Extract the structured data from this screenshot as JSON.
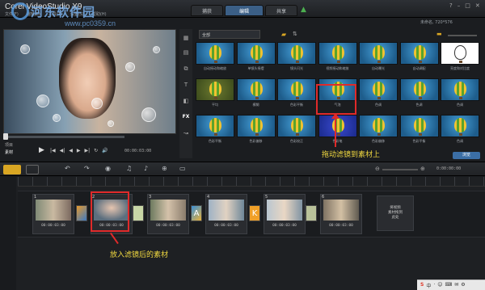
{
  "app": {
    "logo": "Corel VideoStudio X9",
    "project_info": "未命名, 720*576"
  },
  "watermark": {
    "text": "河东软件园",
    "url": "www.pc0359.cn"
  },
  "menu": [
    "文件(F)",
    "编辑(E)",
    "工具(T)",
    "设置(S)",
    "帮助(H)"
  ],
  "tabs": {
    "capture": "捕获",
    "edit": "编辑",
    "share": "共享"
  },
  "window_controls": [
    "?",
    "–",
    "□",
    "✕"
  ],
  "preview": {
    "project_label": "项目",
    "clip_label": "素材",
    "timecode": "00:00:03:00",
    "transport": [
      "|◀",
      "◀|",
      "◀",
      "▶",
      "▶|",
      "↻",
      "🔊"
    ]
  },
  "library": {
    "dropdown": "全部",
    "side_icons": [
      "media-icon",
      "instant-project-icon",
      "transition-icon",
      "title-icon",
      "graphic-icon",
      "fx-icon",
      "path-icon"
    ],
    "fx_label": "FX",
    "thumbs": [
      "自动摇动和缩放",
      "单镜头摇摆",
      "镜头闪光",
      "视频摇动和缩放",
      "自动曝光",
      "自动调配",
      "亮度和对比度",
      "平均",
      "模糊",
      "色彩平衡",
      "气泡",
      "色调",
      "色调",
      "色调",
      "色彩平衡",
      "色彩偏移",
      "色彩校正",
      "色彩笔",
      "色彩偏移",
      "色彩平衡",
      "色调"
    ],
    "browse_label": "浏览"
  },
  "annotations": {
    "drag_text": "拖动滤镜到素材上",
    "result_text": "放入滤镜后的素材"
  },
  "timeline": {
    "time": "0:00:00:00",
    "clips": [
      {
        "num": "1",
        "time": "00:00:03:00"
      },
      {
        "num": "2",
        "time": "00:00:03:00"
      },
      {
        "num": "3",
        "time": "00:00:03:00"
      },
      {
        "num": "4",
        "time": "00:00:03:00"
      },
      {
        "num": "5",
        "time": "00:00:03:00"
      },
      {
        "num": "6",
        "time": "00:00:03:00"
      }
    ],
    "drop_zone": "将视频\n素材拖到\n此处"
  },
  "tray": [
    "S",
    "中",
    "·",
    "☺",
    "⌨",
    "✉",
    "⚙"
  ]
}
